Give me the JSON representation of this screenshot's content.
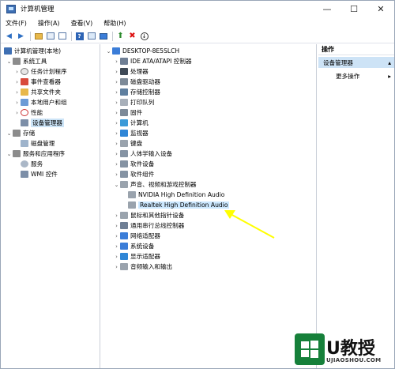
{
  "window": {
    "title": "计算机管理",
    "controls": {
      "minimize": "—",
      "maximize": "☐",
      "close": "✕"
    }
  },
  "menubar": [
    "文件(F)",
    "操作(A)",
    "查看(V)",
    "帮助(H)"
  ],
  "left_tree": {
    "root": "计算机管理(本地)",
    "system_tools": "系统工具",
    "items": [
      "任务计划程序",
      "事件查看器",
      "共享文件夹",
      "本地用户和组",
      "性能",
      "设备管理器"
    ],
    "storage": "存储",
    "disk_mgmt": "磁盘管理",
    "services_apps": "服务和应用程序",
    "services": "服务",
    "wmi": "WMI 控件"
  },
  "device_tree": {
    "root": "DESKTOP-8E5SLCH",
    "categories": [
      "IDE ATA/ATAPI 控制器",
      "处理器",
      "磁盘驱动器",
      "存储控制器",
      "打印队列",
      "固件",
      "计算机",
      "监视器",
      "键盘",
      "人体学输入设备",
      "软件设备",
      "软件组件",
      "声音、视频和游戏控制器"
    ],
    "audio_children": [
      "NVIDIA High Definition Audio",
      "Realtek High Definition Audio"
    ],
    "categories_after": [
      "鼠标和其他指针设备",
      "通用串行总线控制器",
      "网络适配器",
      "系统设备",
      "显示适配器",
      "音频输入和输出"
    ]
  },
  "actions_pane": {
    "header": "操作",
    "selected": "设备管理器",
    "more": "更多操作"
  },
  "watermark": {
    "text": "U教授",
    "url": "UJIAOSHOU.COM"
  },
  "colors": {
    "annotation_arrow": "#ffff00",
    "selection": "#cce4f7",
    "watermark_green": "#16803a"
  }
}
